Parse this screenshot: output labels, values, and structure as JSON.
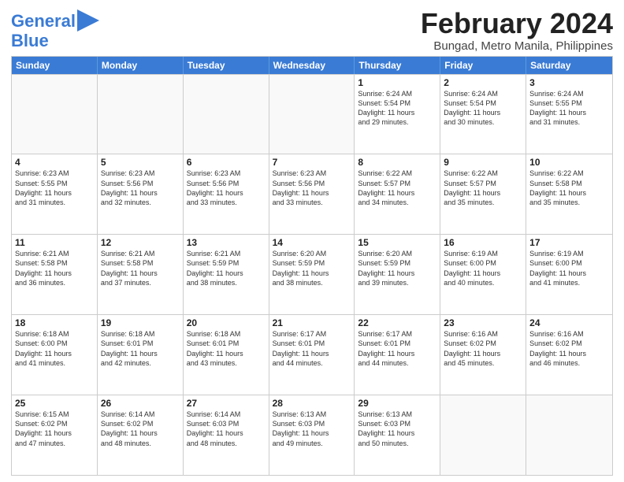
{
  "logo": {
    "line1": "General",
    "line2": "Blue"
  },
  "title": {
    "month": "February 2024",
    "location": "Bungad, Metro Manila, Philippines"
  },
  "weekdays": [
    "Sunday",
    "Monday",
    "Tuesday",
    "Wednesday",
    "Thursday",
    "Friday",
    "Saturday"
  ],
  "weeks": [
    [
      {
        "day": "",
        "lines": []
      },
      {
        "day": "",
        "lines": []
      },
      {
        "day": "",
        "lines": []
      },
      {
        "day": "",
        "lines": []
      },
      {
        "day": "1",
        "lines": [
          "Sunrise: 6:24 AM",
          "Sunset: 5:54 PM",
          "Daylight: 11 hours",
          "and 29 minutes."
        ]
      },
      {
        "day": "2",
        "lines": [
          "Sunrise: 6:24 AM",
          "Sunset: 5:54 PM",
          "Daylight: 11 hours",
          "and 30 minutes."
        ]
      },
      {
        "day": "3",
        "lines": [
          "Sunrise: 6:24 AM",
          "Sunset: 5:55 PM",
          "Daylight: 11 hours",
          "and 31 minutes."
        ]
      }
    ],
    [
      {
        "day": "4",
        "lines": [
          "Sunrise: 6:23 AM",
          "Sunset: 5:55 PM",
          "Daylight: 11 hours",
          "and 31 minutes."
        ]
      },
      {
        "day": "5",
        "lines": [
          "Sunrise: 6:23 AM",
          "Sunset: 5:56 PM",
          "Daylight: 11 hours",
          "and 32 minutes."
        ]
      },
      {
        "day": "6",
        "lines": [
          "Sunrise: 6:23 AM",
          "Sunset: 5:56 PM",
          "Daylight: 11 hours",
          "and 33 minutes."
        ]
      },
      {
        "day": "7",
        "lines": [
          "Sunrise: 6:23 AM",
          "Sunset: 5:56 PM",
          "Daylight: 11 hours",
          "and 33 minutes."
        ]
      },
      {
        "day": "8",
        "lines": [
          "Sunrise: 6:22 AM",
          "Sunset: 5:57 PM",
          "Daylight: 11 hours",
          "and 34 minutes."
        ]
      },
      {
        "day": "9",
        "lines": [
          "Sunrise: 6:22 AM",
          "Sunset: 5:57 PM",
          "Daylight: 11 hours",
          "and 35 minutes."
        ]
      },
      {
        "day": "10",
        "lines": [
          "Sunrise: 6:22 AM",
          "Sunset: 5:58 PM",
          "Daylight: 11 hours",
          "and 35 minutes."
        ]
      }
    ],
    [
      {
        "day": "11",
        "lines": [
          "Sunrise: 6:21 AM",
          "Sunset: 5:58 PM",
          "Daylight: 11 hours",
          "and 36 minutes."
        ]
      },
      {
        "day": "12",
        "lines": [
          "Sunrise: 6:21 AM",
          "Sunset: 5:58 PM",
          "Daylight: 11 hours",
          "and 37 minutes."
        ]
      },
      {
        "day": "13",
        "lines": [
          "Sunrise: 6:21 AM",
          "Sunset: 5:59 PM",
          "Daylight: 11 hours",
          "and 38 minutes."
        ]
      },
      {
        "day": "14",
        "lines": [
          "Sunrise: 6:20 AM",
          "Sunset: 5:59 PM",
          "Daylight: 11 hours",
          "and 38 minutes."
        ]
      },
      {
        "day": "15",
        "lines": [
          "Sunrise: 6:20 AM",
          "Sunset: 5:59 PM",
          "Daylight: 11 hours",
          "and 39 minutes."
        ]
      },
      {
        "day": "16",
        "lines": [
          "Sunrise: 6:19 AM",
          "Sunset: 6:00 PM",
          "Daylight: 11 hours",
          "and 40 minutes."
        ]
      },
      {
        "day": "17",
        "lines": [
          "Sunrise: 6:19 AM",
          "Sunset: 6:00 PM",
          "Daylight: 11 hours",
          "and 41 minutes."
        ]
      }
    ],
    [
      {
        "day": "18",
        "lines": [
          "Sunrise: 6:18 AM",
          "Sunset: 6:00 PM",
          "Daylight: 11 hours",
          "and 41 minutes."
        ]
      },
      {
        "day": "19",
        "lines": [
          "Sunrise: 6:18 AM",
          "Sunset: 6:01 PM",
          "Daylight: 11 hours",
          "and 42 minutes."
        ]
      },
      {
        "day": "20",
        "lines": [
          "Sunrise: 6:18 AM",
          "Sunset: 6:01 PM",
          "Daylight: 11 hours",
          "and 43 minutes."
        ]
      },
      {
        "day": "21",
        "lines": [
          "Sunrise: 6:17 AM",
          "Sunset: 6:01 PM",
          "Daylight: 11 hours",
          "and 44 minutes."
        ]
      },
      {
        "day": "22",
        "lines": [
          "Sunrise: 6:17 AM",
          "Sunset: 6:01 PM",
          "Daylight: 11 hours",
          "and 44 minutes."
        ]
      },
      {
        "day": "23",
        "lines": [
          "Sunrise: 6:16 AM",
          "Sunset: 6:02 PM",
          "Daylight: 11 hours",
          "and 45 minutes."
        ]
      },
      {
        "day": "24",
        "lines": [
          "Sunrise: 6:16 AM",
          "Sunset: 6:02 PM",
          "Daylight: 11 hours",
          "and 46 minutes."
        ]
      }
    ],
    [
      {
        "day": "25",
        "lines": [
          "Sunrise: 6:15 AM",
          "Sunset: 6:02 PM",
          "Daylight: 11 hours",
          "and 47 minutes."
        ]
      },
      {
        "day": "26",
        "lines": [
          "Sunrise: 6:14 AM",
          "Sunset: 6:02 PM",
          "Daylight: 11 hours",
          "and 48 minutes."
        ]
      },
      {
        "day": "27",
        "lines": [
          "Sunrise: 6:14 AM",
          "Sunset: 6:03 PM",
          "Daylight: 11 hours",
          "and 48 minutes."
        ]
      },
      {
        "day": "28",
        "lines": [
          "Sunrise: 6:13 AM",
          "Sunset: 6:03 PM",
          "Daylight: 11 hours",
          "and 49 minutes."
        ]
      },
      {
        "day": "29",
        "lines": [
          "Sunrise: 6:13 AM",
          "Sunset: 6:03 PM",
          "Daylight: 11 hours",
          "and 50 minutes."
        ]
      },
      {
        "day": "",
        "lines": []
      },
      {
        "day": "",
        "lines": []
      }
    ]
  ]
}
